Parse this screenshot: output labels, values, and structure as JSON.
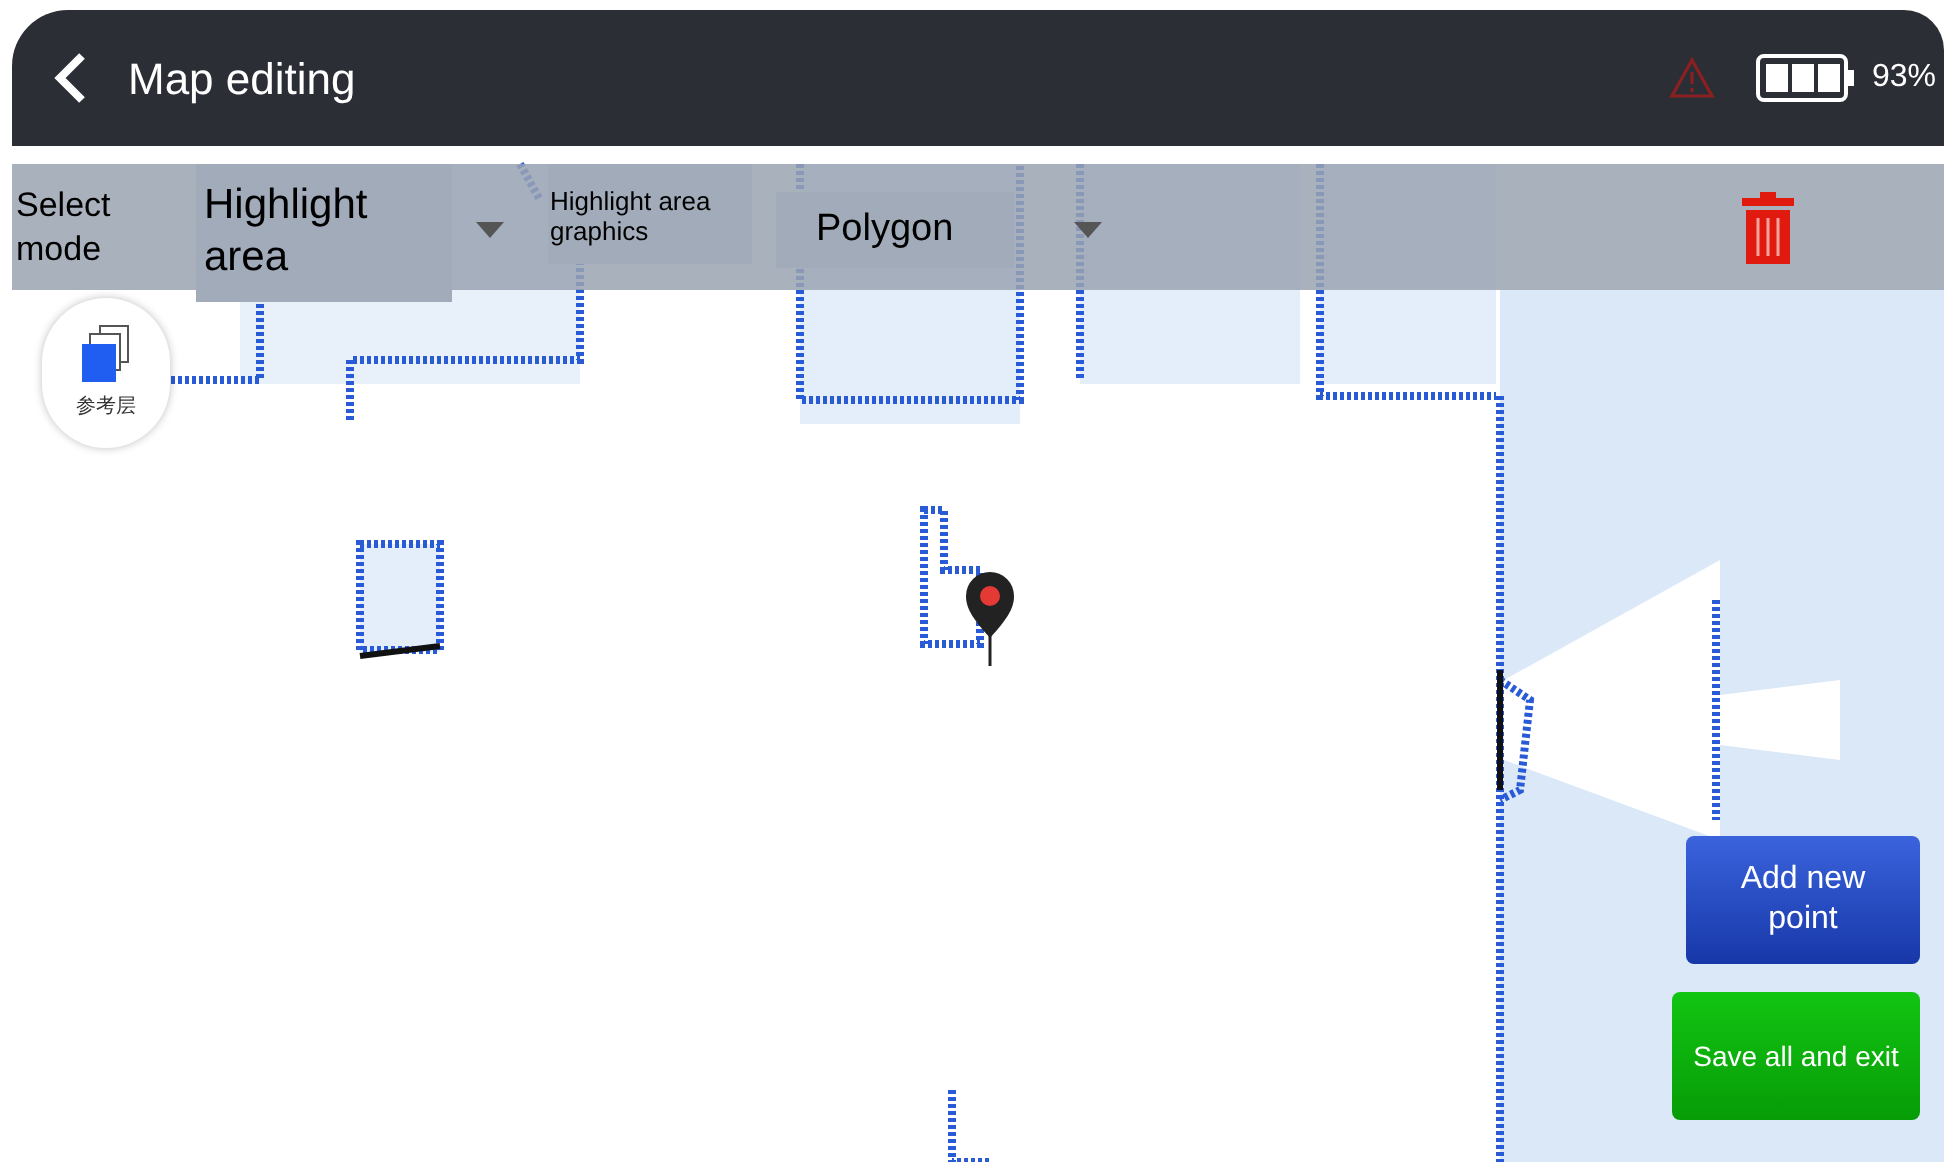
{
  "header": {
    "title": "Map editing",
    "battery_text": "93%"
  },
  "toolbar": {
    "mode_label": "Select mode",
    "mode_value": "Highlight area",
    "graphics_label": "Highlight area graphics",
    "graphics_value": "Polygon"
  },
  "layer_button": {
    "label": "参考层"
  },
  "buttons": [
    {
      "label": "Add new point",
      "kind": "blue"
    },
    {
      "label": "Save all and exit",
      "kind": "green"
    }
  ]
}
